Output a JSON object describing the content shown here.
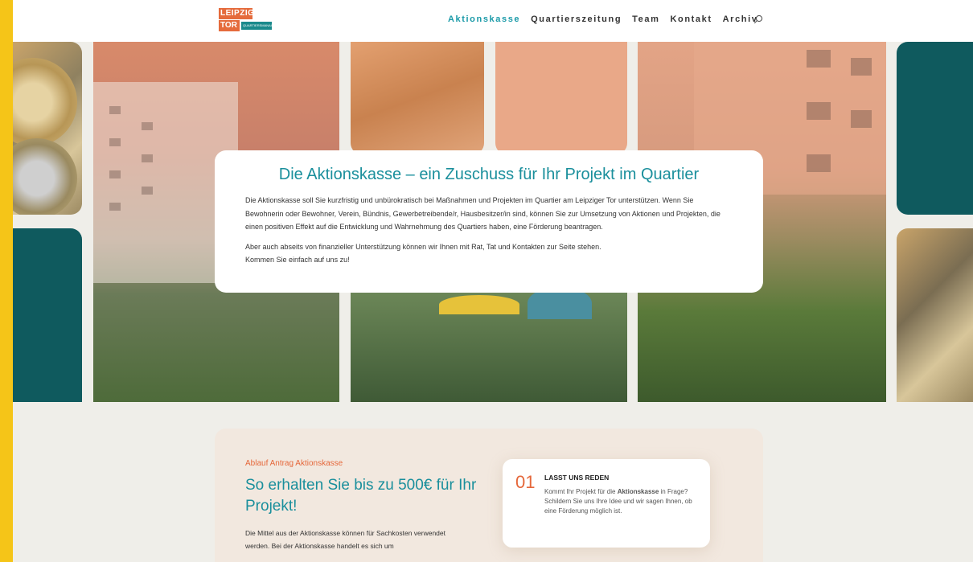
{
  "header": {
    "logo": {
      "line1": "LEIPZIGER",
      "line2": "TOR",
      "line3": "QUARTIERS­MANAGEMENT"
    },
    "nav": [
      "Aktionskasse",
      "Quartierszeitung",
      "Team",
      "Kontakt",
      "Archiv"
    ],
    "active_nav": "Aktionskasse",
    "search_icon": "search-icon"
  },
  "hero_card": {
    "title": "Die Aktionskasse – ein Zuschuss für Ihr Projekt im Quartier",
    "paragraph1": "Die Aktionskasse soll Sie kurzfristig und unbürokratisch bei Maßnahmen und Projekten im Quartier am Leipziger Tor unterstützen. Wenn Sie Bewohnerin oder Bewohner, Verein, Bündnis, Gewerbetreibende/r, Hausbesitzer/in sind, können Sie zur Umsetzung von Aktionen und Projekten, die einen positiven Effekt auf die Entwicklung und Wahrnehmung des Quartiers haben, eine Förderung beantragen.",
    "paragraph2_line1": "Aber auch abseits von finanzieller Unterstützung können wir Ihnen mit Rat, Tat und Kontakten zur Seite stehen.",
    "paragraph2_line2": "Kommen Sie einfach auf uns zu!"
  },
  "section": {
    "subtitle": "Ablauf Antrag Aktionskasse",
    "title": "So erhalten Sie bis zu 500€ für Ihr Projekt!",
    "text": "Die Mittel aus der Aktionskasse können für Sachkosten verwendet werden. Bei der Aktionskasse handelt es sich um",
    "step": {
      "number": "01",
      "heading": "LASST UNS REDEN",
      "body_part1": "Kommt Ihr Projekt für die ",
      "body_bold": "Aktionskasse",
      "body_part2": " in Frage?",
      "body_line2": "Schildern Sie uns Ihre Idee und wir sagen Ihnen, ob eine Förderung möglich ist."
    }
  },
  "colors": {
    "accent": "#1a8f9c",
    "orange": "#e5673a",
    "teal_dark": "#0f5a5e",
    "frame": "#f5c518"
  }
}
